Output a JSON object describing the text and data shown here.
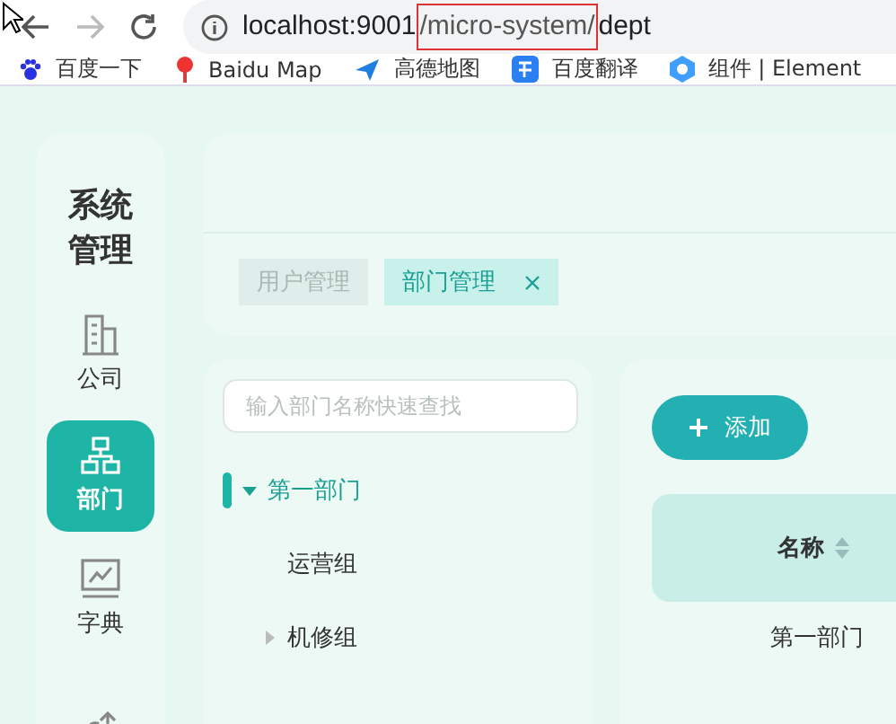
{
  "browser": {
    "url": {
      "before": "localhost:9001",
      "marked": "/micro-system/",
      "after": "dept"
    },
    "bookmarks": [
      {
        "label": "百度一下",
        "kind": "paw"
      },
      {
        "label": "Baidu Map",
        "kind": "pin"
      },
      {
        "label": "高德地图",
        "kind": "plane"
      },
      {
        "label": "百度翻译",
        "kind": "translate"
      },
      {
        "label": "组件 | Element",
        "kind": "hex"
      }
    ]
  },
  "sidebar": {
    "title": "系统管理",
    "items": [
      {
        "label": "公司",
        "kind": "building",
        "selected": false
      },
      {
        "label": "部门",
        "kind": "org",
        "selected": true
      },
      {
        "label": "字典",
        "kind": "chart",
        "selected": false
      },
      {
        "kind": "share",
        "selected": false
      }
    ]
  },
  "tabs": [
    {
      "label": "用户管理",
      "selected": false
    },
    {
      "label": "部门管理",
      "selected": true
    }
  ],
  "tree": {
    "search": {
      "placeholder": "输入部门名称快速查找"
    },
    "nodes": [
      {
        "label": "第一部门",
        "expanded": true,
        "current": true,
        "children": [
          {
            "label": "运营组",
            "has_children": false
          },
          {
            "label": "机修组",
            "has_children": true
          }
        ]
      }
    ]
  },
  "table": {
    "add_button": "添加",
    "columns": [
      {
        "label": "名称"
      }
    ],
    "rows": [
      [
        "第一部门"
      ]
    ]
  }
}
